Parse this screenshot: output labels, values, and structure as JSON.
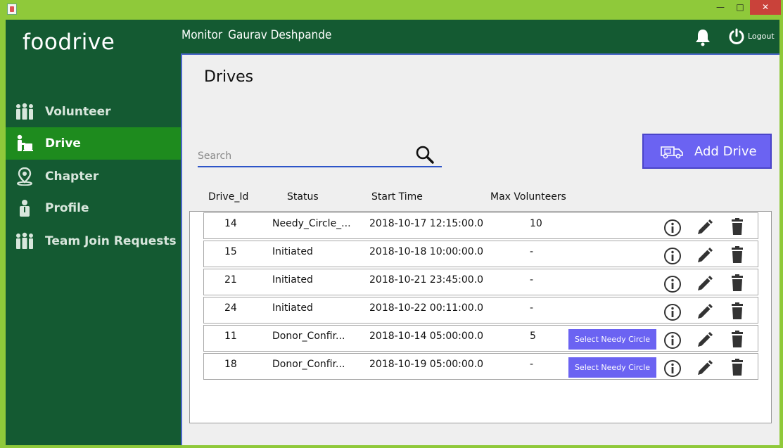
{
  "header": {
    "logo": "foodrive",
    "role": "Monitor",
    "user": "Gaurav Deshpande",
    "logout_label": "Logout"
  },
  "sidebar": {
    "items": [
      {
        "label": "Volunteer",
        "icon": "people-icon",
        "active": false
      },
      {
        "label": "Drive",
        "icon": "drive-icon",
        "active": true
      },
      {
        "label": "Chapter",
        "icon": "location-pin-icon",
        "active": false
      },
      {
        "label": "Profile",
        "icon": "person-icon",
        "active": false
      },
      {
        "label": "Team Join Requests",
        "icon": "people-icon",
        "active": false
      }
    ]
  },
  "main": {
    "title": "Drives",
    "search": {
      "placeholder": "Search",
      "value": ""
    },
    "add_drive_label": "Add Drive",
    "columns": [
      "Drive_Id",
      "Status",
      "Start Time",
      "Max Volunteers"
    ],
    "rows": [
      {
        "id": "14",
        "status": "Needy_Circle_...",
        "start": "2018-10-17 12:15:00.0",
        "max": "10",
        "action": ""
      },
      {
        "id": "15",
        "status": "Initiated",
        "start": "2018-10-18 10:00:00.0",
        "max": "-",
        "action": ""
      },
      {
        "id": "21",
        "status": "Initiated",
        "start": "2018-10-21 23:45:00.0",
        "max": "-",
        "action": ""
      },
      {
        "id": "24",
        "status": "Initiated",
        "start": "2018-10-22 00:11:00.0",
        "max": "-",
        "action": ""
      },
      {
        "id": "11",
        "status": "Donor_Confir...",
        "start": "2018-10-14 05:00:00.0",
        "max": "5",
        "action": "Select Needy Circle"
      },
      {
        "id": "18",
        "status": "Donor_Confir...",
        "start": "2018-10-19 05:00:00.0",
        "max": "-",
        "action": "Select Needy Circle"
      }
    ]
  },
  "colors": {
    "header_green": "#145a32",
    "active_green": "#1e8b1e",
    "frame_green": "#8fc93a",
    "accent_purple": "#6b63f2"
  }
}
